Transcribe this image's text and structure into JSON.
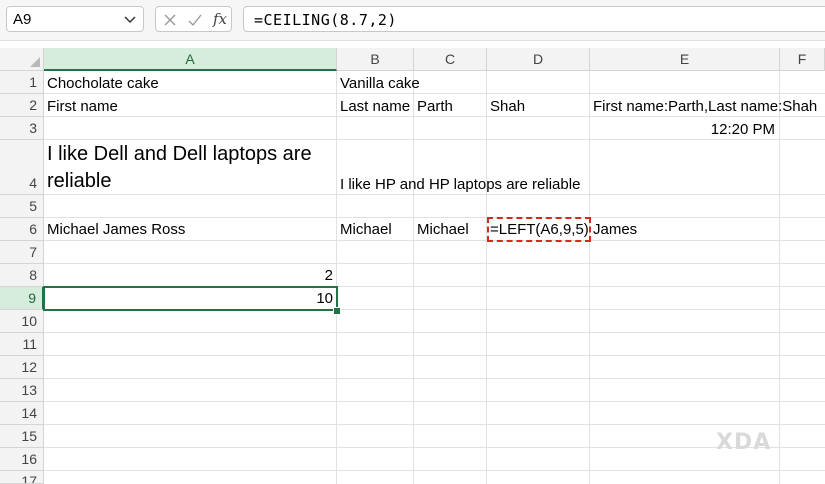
{
  "formula_bar": {
    "name_box": "A9",
    "fx_label": "fx",
    "formula": "=CEILING(8.7,2)"
  },
  "columns": [
    "A",
    "B",
    "C",
    "D",
    "E",
    "F"
  ],
  "rows": [
    "1",
    "2",
    "3",
    "4",
    "5",
    "6",
    "7",
    "8",
    "9",
    "10",
    "11",
    "12",
    "13",
    "14",
    "15",
    "16",
    "17"
  ],
  "cells": {
    "A1": "Chocholate cake",
    "B1": "Vanilla cake",
    "A2": "First name",
    "B2": "Last name",
    "C2": "Parth",
    "D2": "Shah",
    "E2": "First name:Parth,Last name:Shah",
    "E3": "12:20 PM",
    "A4": "I like Dell and Dell laptops are reliable",
    "B4": "I like HP and HP laptops are reliable",
    "A6": "Michael James Ross",
    "B6": "Michael",
    "C6": "Michael",
    "D6": "=LEFT(A6,9,5)",
    "E6": "James",
    "A8": "2",
    "A9": "10"
  },
  "selection": {
    "cell": "A9",
    "color": "#217346"
  },
  "highlight": {
    "cell": "D6",
    "color": "#d42b1e"
  },
  "watermark": "XDA"
}
